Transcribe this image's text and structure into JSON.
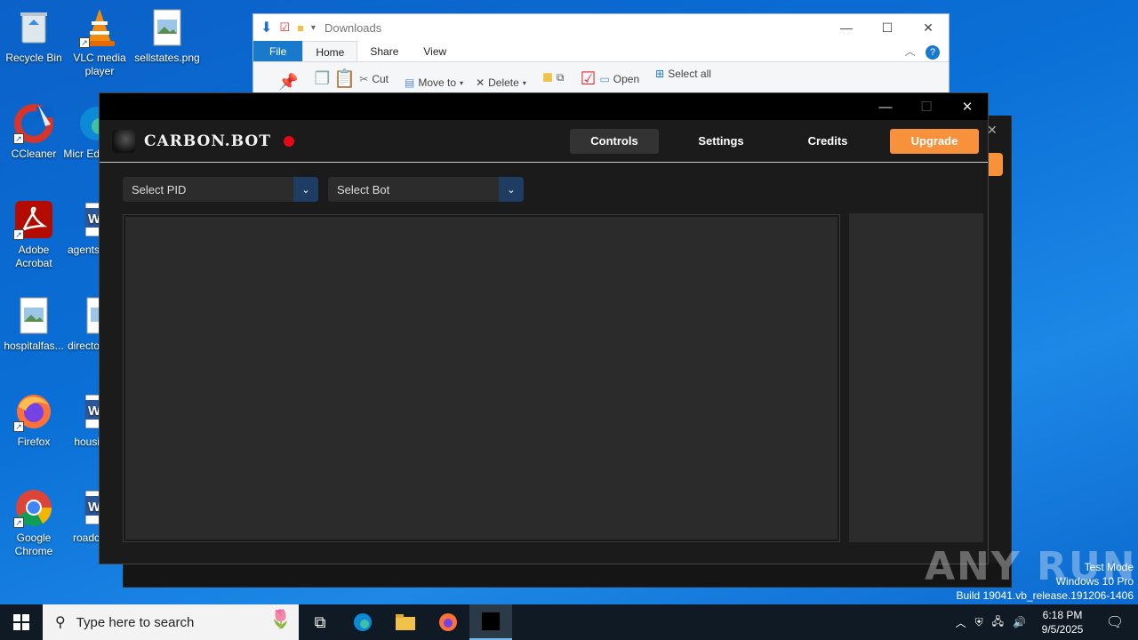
{
  "desktop": {
    "icons": [
      {
        "label": "Recycle Bin"
      },
      {
        "label": "VLC media player"
      },
      {
        "label": "sellstates.png"
      },
      {
        "label": "CCleaner"
      },
      {
        "label": "Micr Ed"
      },
      {
        "label": "Adobe Acrobat"
      },
      {
        "label": "agents"
      },
      {
        "label": "hospitalfas..."
      },
      {
        "label": "directo"
      },
      {
        "label": "Firefox"
      },
      {
        "label": "housi"
      },
      {
        "label": "Google Chrome"
      },
      {
        "label": "roadc"
      }
    ]
  },
  "explorer": {
    "title": "Downloads",
    "tabs": [
      "File",
      "Home",
      "Share",
      "View"
    ],
    "ribbon": {
      "cut": "Cut",
      "move_to": "Move to",
      "delete": "Delete",
      "open": "Open",
      "select_all": "Select all"
    },
    "controls": {
      "minimize": "—",
      "maximize": "☐",
      "close": "✕"
    }
  },
  "carbon": {
    "brand": "CARBON.BOT",
    "window_controls": {
      "minimize": "—",
      "maximize": "☐",
      "close": "✕"
    },
    "nav": {
      "controls": "Controls",
      "settings": "Settings",
      "credits": "Credits",
      "upgrade": "Upgrade"
    },
    "select_pid": "Select PID",
    "select_bot": "Select Bot",
    "accent": "#f7913b",
    "record_color": "#e50914"
  },
  "watermark": {
    "text": "ANY RUN",
    "test_mode": "Test Mode",
    "edition": "Windows 10 Pro",
    "build": "Build 19041.vb_release.191206-1406"
  },
  "taskbar": {
    "search_placeholder": "Type here to search",
    "time": "6:18 PM",
    "date": "9/5/2025"
  }
}
